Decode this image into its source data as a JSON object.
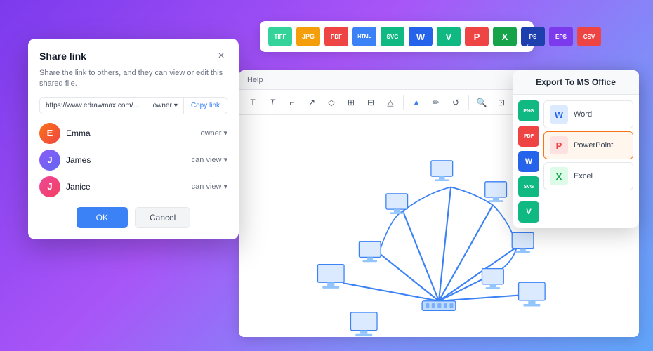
{
  "background": {
    "gradient_start": "#7c3aed",
    "gradient_end": "#60a5fa"
  },
  "export_toolbar": {
    "formats": [
      {
        "label": "TIFF",
        "color": "#34d399"
      },
      {
        "label": "JPG",
        "color": "#f59e0b"
      },
      {
        "label": "PDF",
        "color": "#ef4444"
      },
      {
        "label": "HTML",
        "color": "#3b82f6"
      },
      {
        "label": "SVG",
        "color": "#10b981"
      },
      {
        "label": "W",
        "color": "#2563eb"
      },
      {
        "label": "V",
        "color": "#10b981"
      },
      {
        "label": "P",
        "color": "#ef4444"
      },
      {
        "label": "X",
        "color": "#16a34a"
      },
      {
        "label": "PS",
        "color": "#1e40af"
      },
      {
        "label": "EPS",
        "color": "#7c3aed"
      },
      {
        "label": "CSV",
        "color": "#ef4444"
      }
    ]
  },
  "editor": {
    "help_label": "Help",
    "toolbar_icons": [
      "T",
      "T",
      "⌐",
      "△",
      "○",
      "⊞",
      "⊟",
      "▲",
      "▼",
      "⋮",
      "✏",
      "◉",
      "⟲",
      "🔍",
      "⊡",
      "✎",
      "—",
      "🔒",
      "⊞",
      "⊕"
    ]
  },
  "export_panel": {
    "title": "Export To MS Office",
    "side_badges": [
      {
        "label": "PNG",
        "color": "#10b981"
      },
      {
        "label": "PDF",
        "color": "#ef4444"
      },
      {
        "label": "W",
        "color": "#2563eb"
      },
      {
        "label": "SVG",
        "color": "#10b981"
      },
      {
        "label": "V",
        "color": "#10b981"
      }
    ],
    "items": [
      {
        "label": "Word",
        "icon": "W",
        "icon_color": "#2563eb",
        "icon_bg": "#dbeafe",
        "active": false
      },
      {
        "label": "PowerPoint",
        "icon": "P",
        "icon_color": "#ef4444",
        "icon_bg": "#fee2e2",
        "active": true
      },
      {
        "label": "Excel",
        "icon": "X",
        "icon_color": "#16a34a",
        "icon_bg": "#dcfce7",
        "active": false
      }
    ]
  },
  "share_dialog": {
    "title": "Share link",
    "subtitle": "Share the link to others, and they can view or edit this shared file.",
    "link_url": "https://www.edrawmax.com/online/fil",
    "link_permission": "owner",
    "copy_link_label": "Copy link",
    "users": [
      {
        "name": "Emma",
        "role": "owner",
        "avatar_letter": "E",
        "avatar_class": "avatar-emma"
      },
      {
        "name": "James",
        "role": "can view",
        "avatar_letter": "J",
        "avatar_class": "avatar-james"
      },
      {
        "name": "Janice",
        "role": "can view",
        "avatar_letter": "J",
        "avatar_class": "avatar-janice"
      }
    ],
    "ok_label": "OK",
    "cancel_label": "Cancel"
  }
}
